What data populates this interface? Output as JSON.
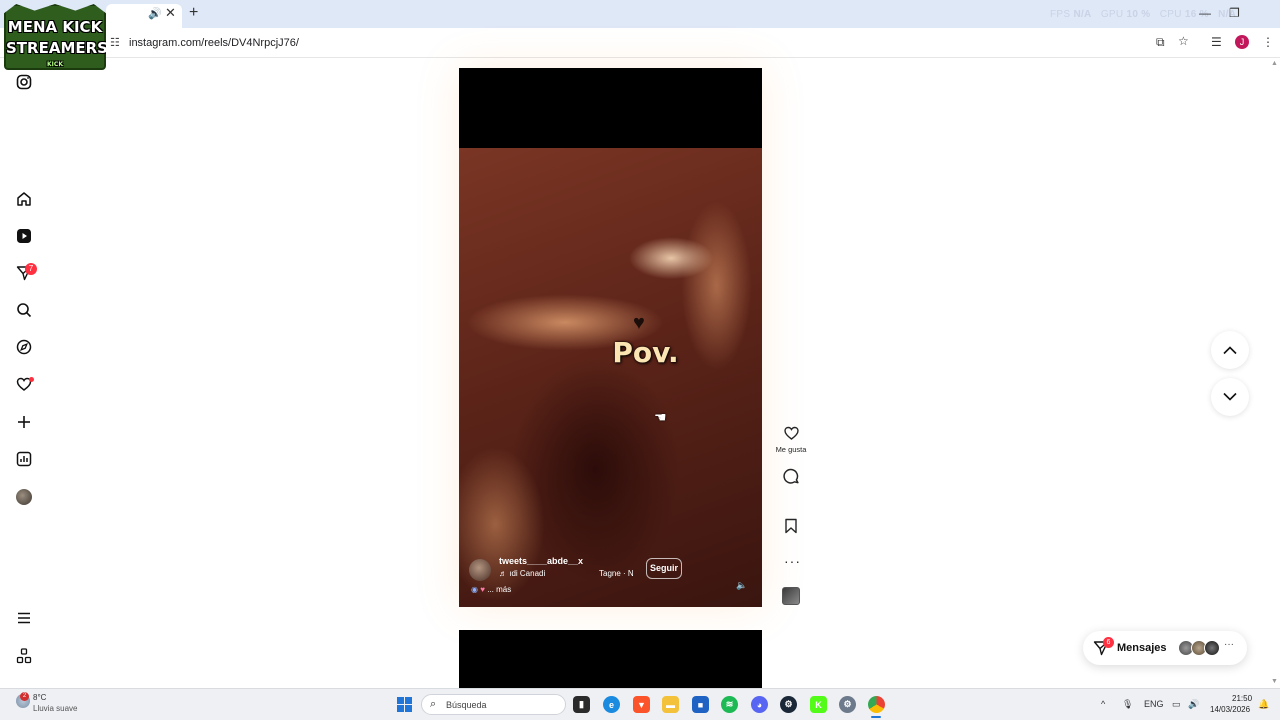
{
  "browser": {
    "url": "instagram.com/reels/DV4NrpcjJ76/",
    "overlay": {
      "fps_label": "FPS",
      "fps_value": "N/A",
      "gpu_label": "GPU",
      "gpu_value": "10 %",
      "cpu_label": "CPU",
      "cpu_value": "16 %",
      "extra": "N/A"
    },
    "profile_initial": "J"
  },
  "logo": {
    "line1": "MENA KICK",
    "line2": "STREAMERS",
    "line3": "KICK"
  },
  "sidebar": {
    "notifications_badge": "7",
    "items": [
      {
        "icon": "instagram-icon"
      },
      {
        "icon": "home-icon"
      },
      {
        "icon": "reels-icon"
      },
      {
        "icon": "messages-icon"
      },
      {
        "icon": "search-icon"
      },
      {
        "icon": "explore-icon"
      },
      {
        "icon": "notifications-icon"
      },
      {
        "icon": "create-icon"
      },
      {
        "icon": "dashboard-icon"
      },
      {
        "icon": "profile-icon"
      },
      {
        "icon": "menu-icon"
      },
      {
        "icon": "apps-icon"
      }
    ]
  },
  "reel": {
    "overlay_text": "Pov.",
    "username": "tweets____abde__x",
    "music": "♬ ıdi Canadi",
    "tagged": "Tagne · N",
    "follow_label": "Seguir",
    "caption_more": "... más"
  },
  "actions": {
    "like_label": "Me gusta"
  },
  "messages": {
    "label": "Mensajes",
    "badge": "6"
  },
  "taskbar": {
    "weather_temp": "8°C",
    "weather_desc": "Lluvia suave",
    "weather_badge": "2",
    "search_placeholder": "Búsqueda",
    "language": "ENG",
    "time": "21:50",
    "date": "14/03/2026"
  },
  "colors": {
    "accent_red": "#ff3040",
    "windows_blue": "#1f75d8",
    "reel_tone": "#5c2419"
  }
}
